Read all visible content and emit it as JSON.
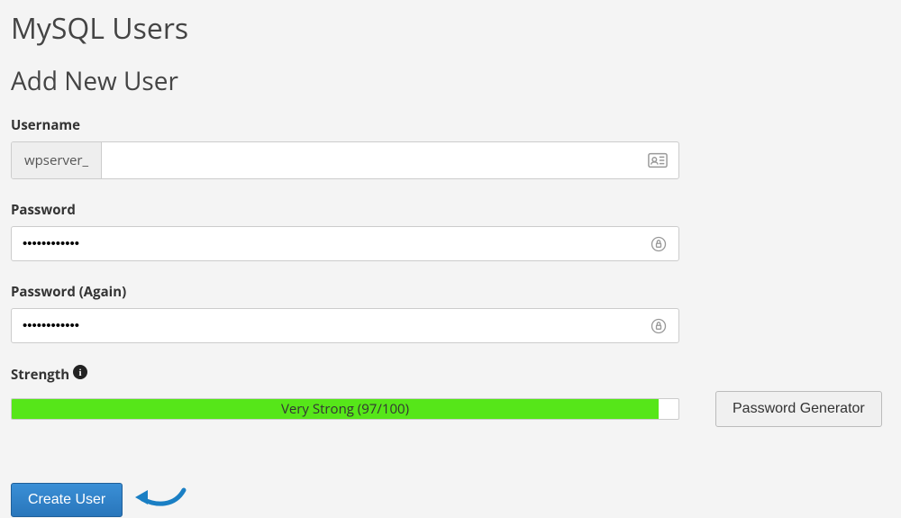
{
  "headings": {
    "page_title": "MySQL Users",
    "section_title": "Add New User"
  },
  "form": {
    "username": {
      "label": "Username",
      "prefix": "wpserver_",
      "value": ""
    },
    "password": {
      "label": "Password",
      "value": "••••••••••••"
    },
    "password_again": {
      "label": "Password (Again)",
      "value": "••••••••••••"
    },
    "strength": {
      "label": "Strength",
      "text": "Very Strong (97/100)",
      "percent": 97
    }
  },
  "buttons": {
    "password_generator": "Password Generator",
    "create_user": "Create User"
  }
}
